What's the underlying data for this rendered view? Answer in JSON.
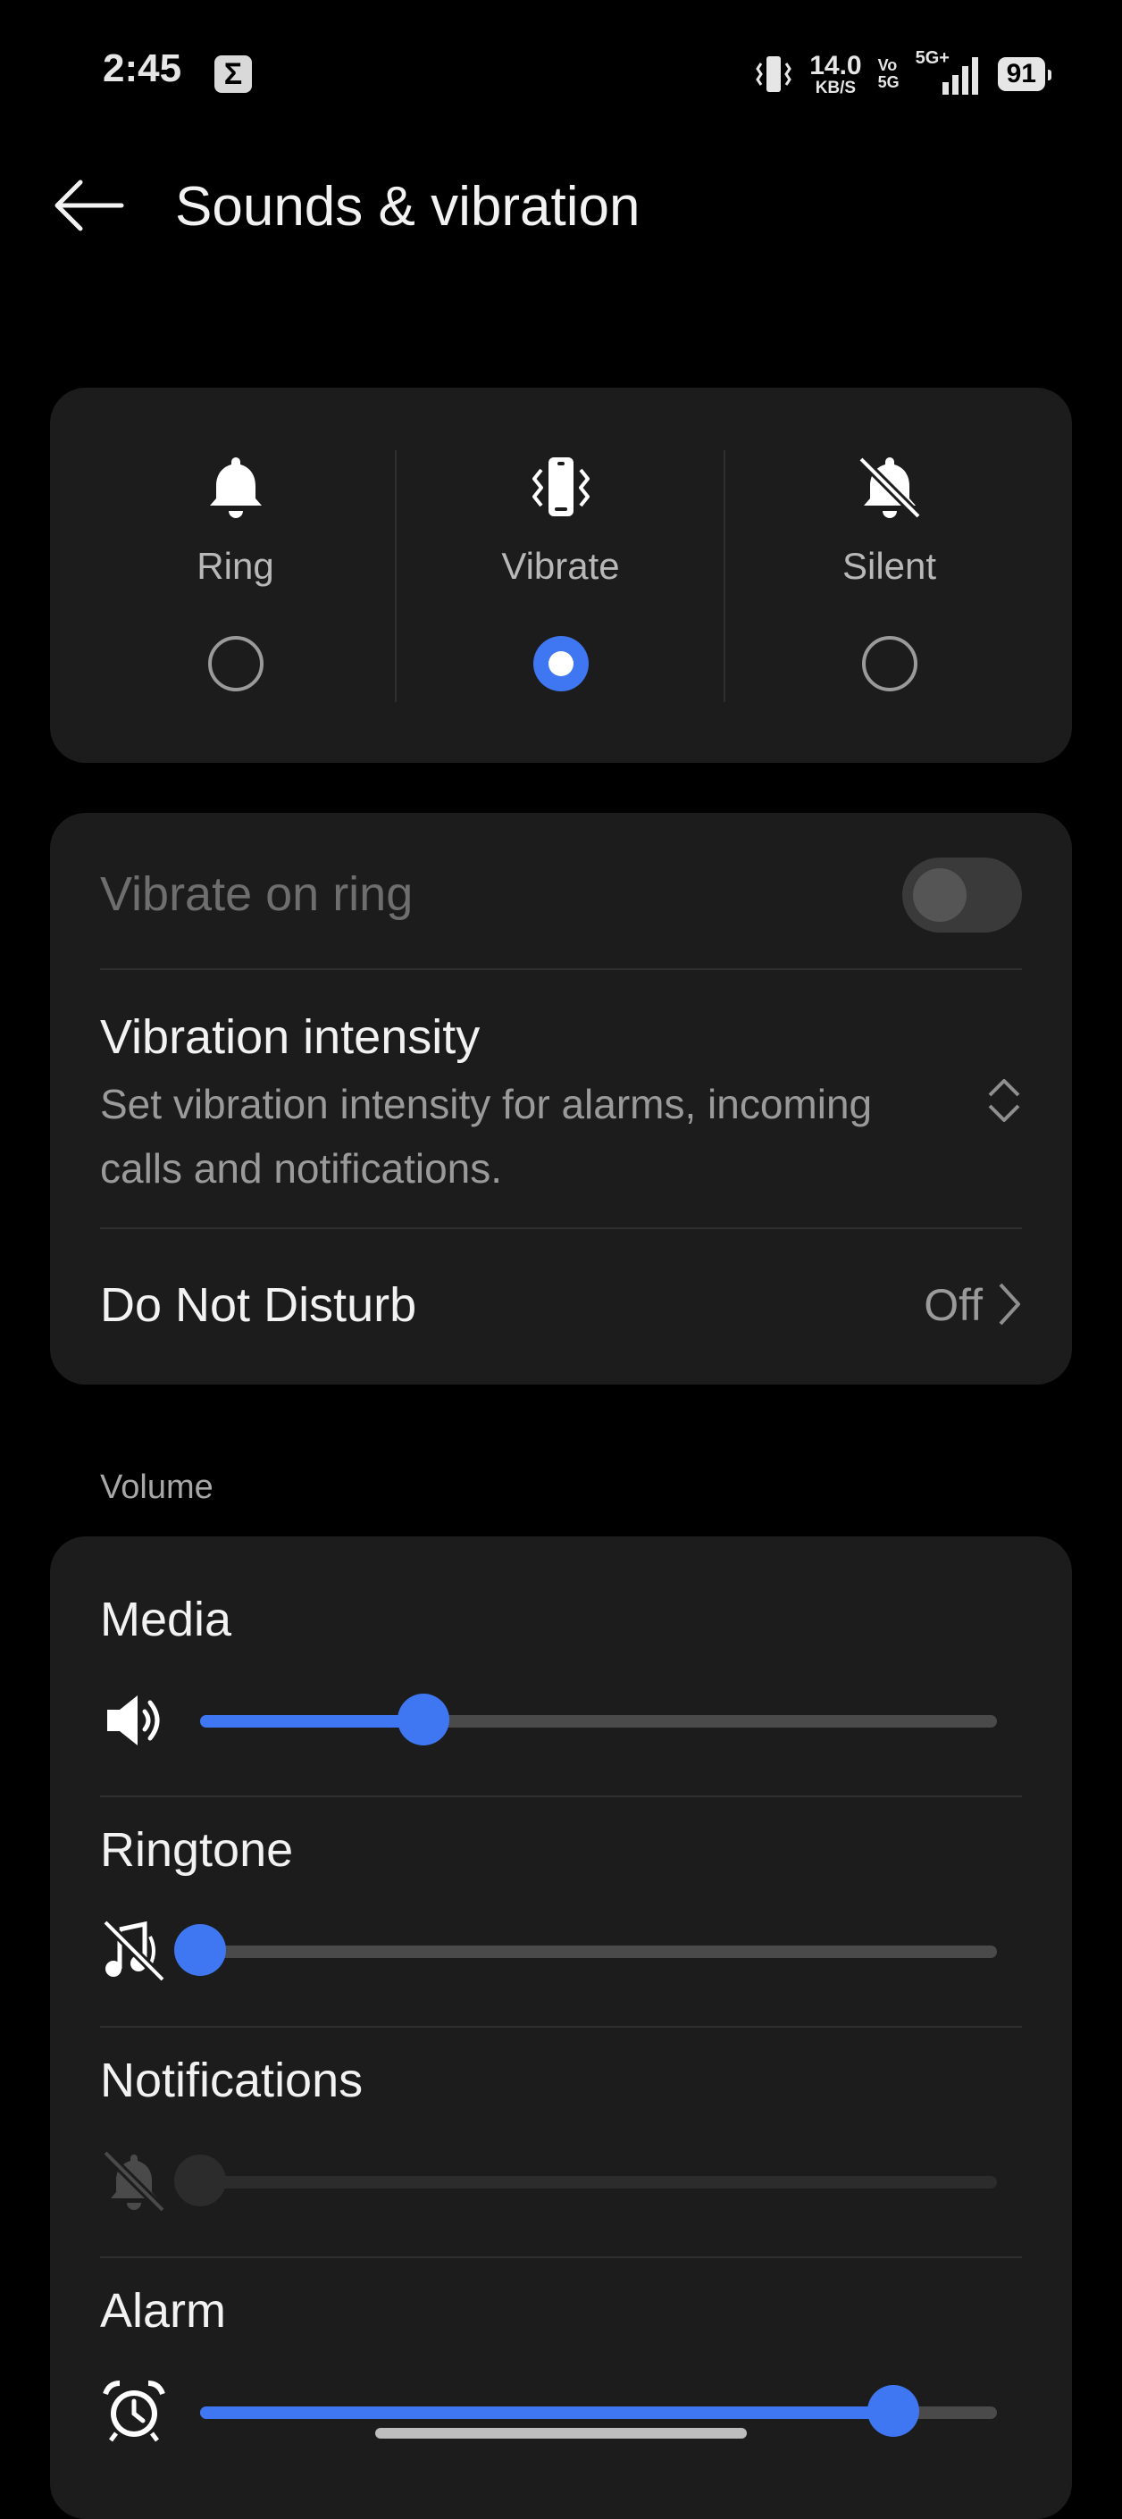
{
  "status_bar": {
    "time": "2:45",
    "notif_icon": "Σ",
    "net_speed_value": "14.0",
    "net_speed_unit": "KB/S",
    "volte_top": "Vo",
    "volte_bottom": "5G",
    "network": "5G+",
    "battery": "91"
  },
  "header": {
    "title": "Sounds & vibration"
  },
  "modes": [
    {
      "label": "Ring",
      "icon": "bell-icon",
      "selected": false
    },
    {
      "label": "Vibrate",
      "icon": "vibrate-phone-icon",
      "selected": true
    },
    {
      "label": "Silent",
      "icon": "bell-off-icon",
      "selected": false
    }
  ],
  "settings": {
    "vibrate_on_ring": {
      "label": "Vibrate on ring",
      "enabled": false,
      "on": false
    },
    "vibration_intensity": {
      "label": "Vibration intensity",
      "description_line1": "Set vibration intensity for alarms, incoming",
      "description_line2": "calls and notifications."
    },
    "do_not_disturb": {
      "label": "Do Not Disturb",
      "value": "Off"
    }
  },
  "volume": {
    "section_label": "Volume",
    "items": [
      {
        "label": "Media",
        "icon": "speaker-icon",
        "level": 0.28,
        "enabled": true
      },
      {
        "label": "Ringtone",
        "icon": "ringtone-muted-icon",
        "level": 0.0,
        "enabled": true
      },
      {
        "label": "Notifications",
        "icon": "notification-muted-icon",
        "level": 0.0,
        "enabled": false
      },
      {
        "label": "Alarm",
        "icon": "alarm-clock-icon",
        "level": 0.87,
        "enabled": true
      }
    ]
  },
  "colors": {
    "accent": "#3f77f2",
    "card": "#1c1c1c",
    "background": "#000000"
  }
}
